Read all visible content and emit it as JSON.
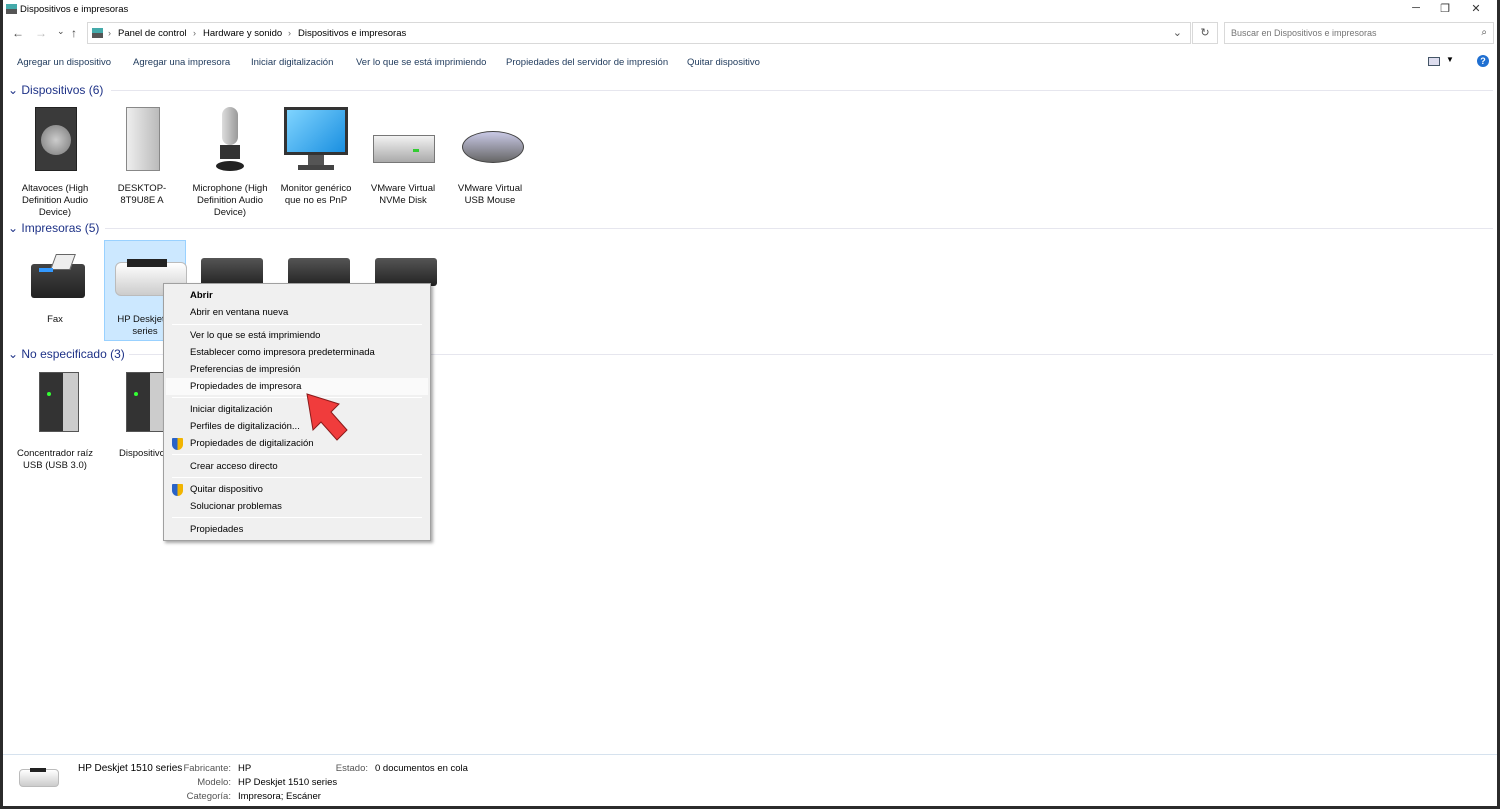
{
  "window": {
    "title": "Dispositivos e impresoras",
    "minimize": "─",
    "restore": "❐",
    "close": "✕"
  },
  "nav": {
    "back": "←",
    "forward": "→",
    "recent": "⌄",
    "up": "↑"
  },
  "address": {
    "crumbs": [
      "Panel de control",
      "Hardware y sonido",
      "Dispositivos e impresoras"
    ],
    "dropdown": "⌄",
    "refresh": "↻"
  },
  "search": {
    "placeholder": "Buscar en Dispositivos e impresoras",
    "icon": "search-icon"
  },
  "toolbar": {
    "items": [
      "Agregar un dispositivo",
      "Agregar una impresora",
      "Iniciar digitalización",
      "Ver lo que se está imprimiendo",
      "Propiedades del servidor de impresión",
      "Quitar dispositivo"
    ],
    "help": "?"
  },
  "groups": [
    {
      "title": "Dispositivos (6)",
      "items": [
        "Altavoces (High Definition Audio Device)",
        "DESKTOP-8T9U8E A",
        "Microphone (High Definition Audio Device)",
        "Monitor genérico que no es PnP",
        "VMware Virtual NVMe Disk",
        "VMware Virtual USB Mouse"
      ]
    },
    {
      "title": "Impresoras (5)",
      "items": [
        "Fax",
        "HP Deskjet 1 series"
      ]
    },
    {
      "title": "No especificado (3)",
      "items": [
        "Concentrador raíz USB (USB 3.0)",
        "Dispositivo"
      ]
    }
  ],
  "context_menu": {
    "items": [
      "Abrir",
      "Abrir en ventana nueva",
      "Ver lo que se está imprimiendo",
      "Establecer como impresora predeterminada",
      "Preferencias de impresión",
      "Propiedades de impresora",
      "Iniciar digitalización",
      "Perfiles de digitalización...",
      "Propiedades de digitalización",
      "Crear acceso directo",
      "Quitar dispositivo",
      "Solucionar problemas",
      "Propiedades"
    ],
    "highlighted": "Propiedades de impresora"
  },
  "status": {
    "name": "HP Deskjet 1510 series",
    "fabricante_label": "Fabricante:",
    "fabricante": "HP",
    "modelo_label": "Modelo:",
    "modelo": "HP Deskjet 1510 series",
    "categoria_label": "Categoría:",
    "categoria": "Impresora; Escáner",
    "estado_label": "Estado:",
    "estado": "0 documentos en cola"
  },
  "colors": {
    "accent": "#1e3287",
    "selection": "#cce8ff",
    "arrow": "#f03c3c"
  }
}
